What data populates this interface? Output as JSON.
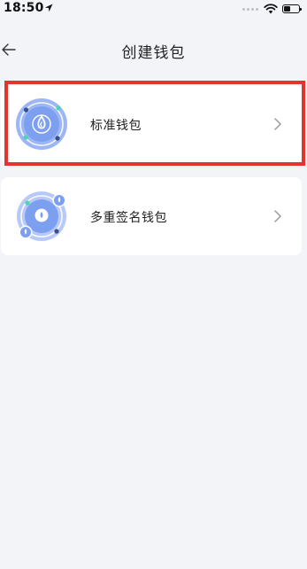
{
  "status_bar": {
    "time": "18:50",
    "location_icon": "location-arrow-icon",
    "wifi_icon": "wifi-icon",
    "battery_icon": "battery-icon"
  },
  "nav": {
    "title": "创建钱包",
    "back_icon": "back-arrow-icon"
  },
  "wallet_types": [
    {
      "label": "标准钱包",
      "icon": "standard-wallet-icon",
      "chevron_icon": "chevron-right-icon",
      "highlighted": true
    },
    {
      "label": "多重签名钱包",
      "icon": "multisig-wallet-icon",
      "chevron_icon": "chevron-right-icon",
      "highlighted": false
    }
  ],
  "colors": {
    "background": "#f3f4f8",
    "card": "#ffffff",
    "icon_blue": "#7d9ff0",
    "icon_dark": "#3b4f8c",
    "icon_teal": "#4fd3b5",
    "highlight_red": "#e5332d"
  }
}
